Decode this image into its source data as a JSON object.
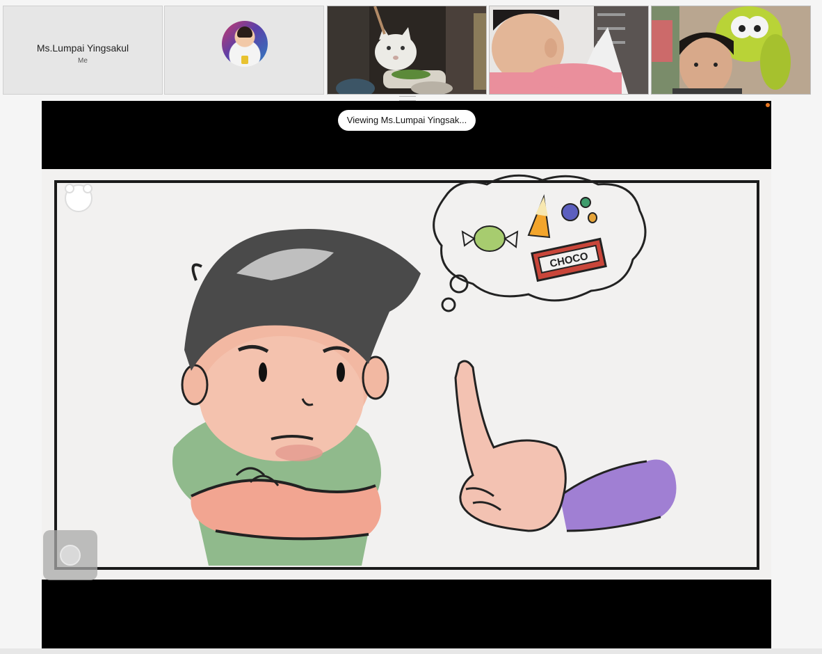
{
  "participants": [
    {
      "name": "Ms.Lumpai Yingsakul",
      "subtitle": "Me",
      "kind": "name-tile"
    },
    {
      "kind": "avatar-tile"
    },
    {
      "kind": "video-tile"
    },
    {
      "kind": "video-tile"
    },
    {
      "kind": "video-tile"
    }
  ],
  "stage": {
    "viewing_label": "Viewing Ms.Lumpai Yingsak...",
    "slide_text": "CHOCO"
  },
  "icons": {
    "drag": "drag-handle-icon",
    "record": "recording-indicator-icon",
    "float": "floating-control-icon",
    "logo": "app-logo-icon"
  },
  "colors": {
    "stage_bg": "#000000",
    "recording": "#e87722",
    "pill_bg": "#ffffff"
  }
}
